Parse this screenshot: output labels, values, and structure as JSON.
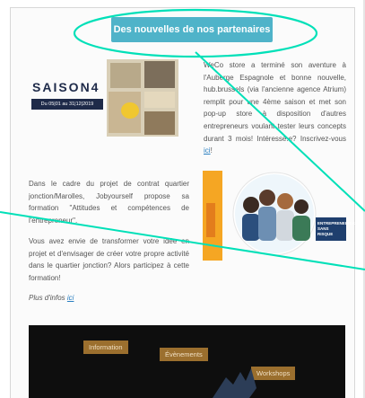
{
  "header": {
    "title": "Des nouvelles de nos partenaires"
  },
  "section1": {
    "badge_title": "SAISON4",
    "badge_sub": "Du 05|01 au 31|12|2019",
    "text": "WeCo store a terminé son aventure à l'Auberge Espagnole et bonne nouvelle, hub.brussels (via l'ancienne agence Atrium) remplit pour une 4ème saison et met son pop-up store à disposition d'autres entrepreneurs voulant tester leurs concepts durant 3 mois! Intéressé.e? Inscrivez-vous",
    "link": "ici",
    "suffix": "!"
  },
  "section2": {
    "para1": "Dans le cadre du projet de contrat quartier jonction/Marolles, Jobyourself propose sa formation \"Attitudes et compétences de l'entrepreneur\".",
    "para2": "Vous avez envie de transformer votre idée en projet et d'envisager de créer votre propre activité dans le quartier jonction? Alors participez à cette formation!",
    "more_prefix": "Plus d'infos",
    "more_link": "ici",
    "badge_text": "ENTREPRENEURIAT SANS RISQUE"
  },
  "video": {
    "tags": [
      "Information",
      "Évènements",
      "Workshops"
    ]
  },
  "colors": {
    "header_bg": "#4fb3c9",
    "annotation": "#00e0b8",
    "link": "#2a7fc1"
  }
}
